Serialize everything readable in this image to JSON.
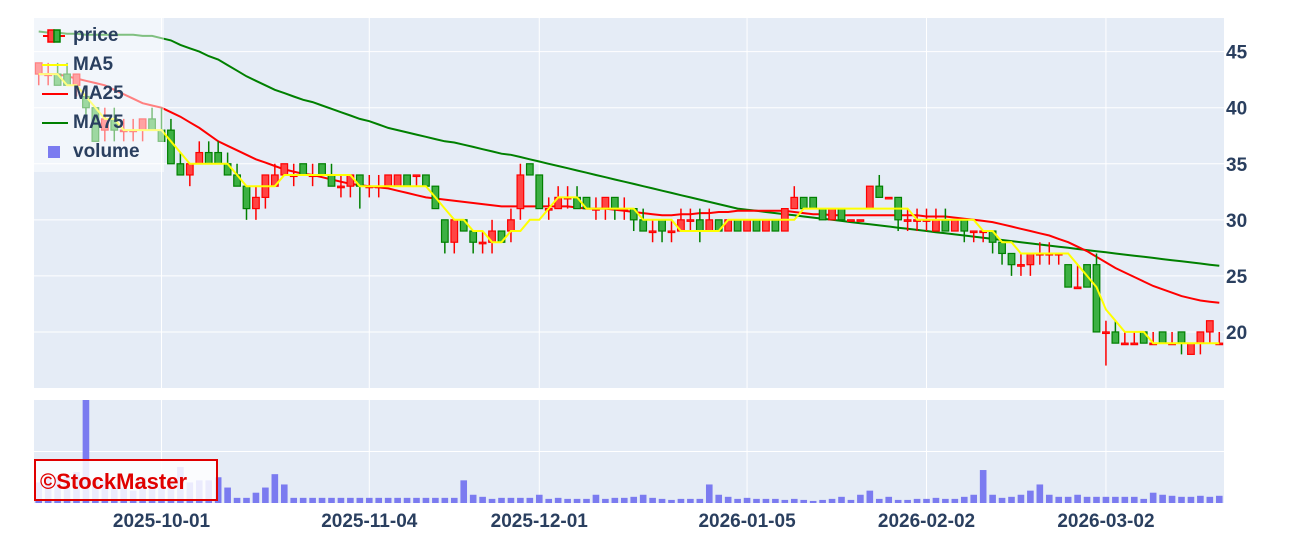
{
  "chart_data": {
    "type": "candlestick",
    "title": "",
    "legend": [
      "price",
      "MA5",
      "MA25",
      "MA75",
      "volume"
    ],
    "legend_position": "top-left",
    "price_axis": {
      "side": "right",
      "range": [
        15,
        48
      ],
      "ticks": [
        20,
        25,
        30,
        35,
        40,
        45
      ]
    },
    "x_tick_labels": [
      "2025-10-01",
      "2025-11-04",
      "2025-12-01",
      "2026-01-05",
      "2026-02-02",
      "2026-03-02"
    ],
    "x_tick_index": [
      13,
      35,
      53,
      75,
      94,
      113
    ],
    "grid": true,
    "colors": {
      "up": "#ff0000",
      "down": "#008000",
      "ma5": "#ffff00",
      "ma25": "#ff0000",
      "ma75": "#008000",
      "volume": "#7b7bf0",
      "plot_bg": "#e5ecf6"
    },
    "candles": [
      [
        43,
        44,
        42,
        44
      ],
      [
        43,
        44,
        42,
        43
      ],
      [
        43,
        44,
        42,
        42
      ],
      [
        43,
        44,
        42,
        42
      ],
      [
        42,
        43,
        41,
        43
      ],
      [
        41,
        42,
        39,
        40
      ],
      [
        40,
        40,
        37,
        37
      ],
      [
        38,
        40,
        37,
        39
      ],
      [
        39,
        40,
        37,
        38
      ],
      [
        38,
        39,
        37,
        38
      ],
      [
        38,
        39,
        37,
        38
      ],
      [
        38,
        39,
        37,
        39
      ],
      [
        39,
        40,
        38,
        38
      ],
      [
        38,
        40,
        37,
        37
      ],
      [
        38,
        39,
        36,
        35
      ],
      [
        35,
        36,
        34,
        34
      ],
      [
        34,
        35,
        33,
        35
      ],
      [
        35,
        37,
        35,
        36
      ],
      [
        36,
        37,
        35,
        35
      ],
      [
        36,
        37,
        35,
        35
      ],
      [
        35,
        36,
        34,
        34
      ],
      [
        34,
        35,
        33,
        33
      ],
      [
        33,
        33,
        30,
        31
      ],
      [
        31,
        33,
        30,
        32
      ],
      [
        32,
        34,
        31,
        34
      ],
      [
        33,
        35,
        33,
        34
      ],
      [
        34,
        35,
        34,
        35
      ],
      [
        34,
        35,
        33,
        34
      ],
      [
        35,
        35,
        34,
        34
      ],
      [
        34,
        35,
        33,
        34
      ],
      [
        35,
        35,
        34,
        34
      ],
      [
        34,
        35,
        33,
        33
      ],
      [
        33,
        34,
        32,
        33
      ],
      [
        33,
        34,
        32,
        34
      ],
      [
        34,
        34,
        31,
        33
      ],
      [
        33,
        34,
        32,
        33
      ],
      [
        33,
        34,
        32,
        33
      ],
      [
        33,
        34,
        33,
        34
      ],
      [
        33,
        34,
        33,
        34
      ],
      [
        34,
        34,
        33,
        33
      ],
      [
        34,
        34,
        33,
        34
      ],
      [
        34,
        34,
        33,
        33
      ],
      [
        33,
        33,
        31,
        31
      ],
      [
        30,
        30,
        27,
        28
      ],
      [
        28,
        30,
        27,
        30
      ],
      [
        30,
        30,
        29,
        29
      ],
      [
        29,
        29,
        27,
        28
      ],
      [
        28,
        29,
        27,
        28
      ],
      [
        28,
        30,
        27,
        29
      ],
      [
        29,
        29,
        28,
        28
      ],
      [
        29,
        31,
        28,
        30
      ],
      [
        31,
        35,
        30,
        34
      ],
      [
        35,
        35,
        34,
        34
      ],
      [
        34,
        34,
        31,
        31
      ],
      [
        31,
        32,
        30,
        31
      ],
      [
        31,
        33,
        31,
        32
      ],
      [
        32,
        33,
        31,
        32
      ],
      [
        32,
        33,
        31,
        31
      ],
      [
        32,
        32,
        31,
        31
      ],
      [
        31,
        32,
        30,
        31
      ],
      [
        31,
        32,
        30,
        32
      ],
      [
        32,
        32,
        30,
        31
      ],
      [
        31,
        32,
        30,
        31
      ],
      [
        31,
        31,
        29,
        30
      ],
      [
        30,
        31,
        29,
        29
      ],
      [
        29,
        30,
        28,
        29
      ],
      [
        30,
        30,
        28,
        29
      ],
      [
        29,
        30,
        28,
        29
      ],
      [
        29,
        31,
        29,
        30
      ],
      [
        30,
        31,
        29,
        30
      ],
      [
        30,
        31,
        28,
        29
      ],
      [
        29,
        31,
        29,
        30
      ],
      [
        30,
        30,
        29,
        29
      ],
      [
        29,
        30,
        29,
        30
      ],
      [
        30,
        30,
        29,
        29
      ],
      [
        29,
        30,
        29,
        30
      ],
      [
        30,
        30,
        29,
        29
      ],
      [
        29,
        30,
        29,
        30
      ],
      [
        30,
        30,
        29,
        29
      ],
      [
        29,
        31,
        29,
        31
      ],
      [
        31,
        33,
        31,
        32
      ],
      [
        32,
        32,
        31,
        31
      ],
      [
        32,
        32,
        31,
        31
      ],
      [
        31,
        31,
        30,
        30
      ],
      [
        30,
        31,
        30,
        31
      ],
      [
        31,
        31,
        30,
        30
      ],
      [
        30,
        30,
        30,
        30
      ],
      [
        30,
        30,
        30,
        30
      ],
      [
        31,
        33,
        31,
        33
      ],
      [
        33,
        34,
        32,
        32
      ],
      [
        32,
        32,
        32,
        32
      ],
      [
        32,
        32,
        29,
        30
      ],
      [
        30,
        31,
        29,
        30
      ],
      [
        30,
        31,
        29,
        30
      ],
      [
        30,
        31,
        29,
        30
      ],
      [
        29,
        31,
        29,
        30
      ],
      [
        30,
        31,
        29,
        29
      ],
      [
        29,
        30,
        29,
        30
      ],
      [
        30,
        30,
        28,
        29
      ],
      [
        29,
        29,
        28,
        29
      ],
      [
        29,
        29,
        28,
        29
      ],
      [
        29,
        29,
        27,
        28
      ],
      [
        28,
        28,
        26,
        27
      ],
      [
        27,
        27,
        25,
        26
      ],
      [
        26,
        27,
        25,
        26
      ],
      [
        26,
        27,
        25,
        27
      ],
      [
        27,
        28,
        26,
        27
      ],
      [
        27,
        28,
        26,
        27
      ],
      [
        27,
        27,
        26,
        27
      ],
      [
        26,
        26,
        24,
        24
      ],
      [
        24,
        26,
        24,
        24
      ],
      [
        26,
        26,
        24,
        24
      ],
      [
        26,
        27,
        23,
        20
      ],
      [
        20,
        21,
        17,
        20
      ],
      [
        20,
        21,
        19,
        19
      ],
      [
        19,
        20,
        19,
        19
      ],
      [
        19,
        20,
        19,
        19
      ],
      [
        20,
        20,
        19,
        19
      ],
      [
        19,
        20,
        19,
        19
      ],
      [
        20,
        20,
        19,
        19
      ],
      [
        19,
        20,
        19,
        19
      ],
      [
        20,
        20,
        18,
        19
      ],
      [
        18,
        19,
        18,
        19
      ],
      [
        19,
        20,
        18,
        20
      ],
      [
        20,
        21,
        19,
        21
      ],
      [
        19,
        20,
        19,
        19
      ]
    ],
    "ma5": [
      43,
      43,
      43,
      42,
      42,
      41,
      40,
      39,
      39,
      38,
      38,
      38,
      38,
      38,
      37,
      36,
      35,
      35,
      35,
      35,
      35,
      34,
      33,
      33,
      33,
      33,
      34,
      34,
      34,
      34,
      34,
      34,
      34,
      34,
      33,
      33,
      33,
      33,
      33,
      33,
      33,
      33,
      32,
      31,
      30,
      30,
      29,
      29,
      28,
      28,
      29,
      29,
      30,
      30,
      31,
      32,
      32,
      32,
      31,
      31,
      31,
      31,
      31,
      31,
      30,
      30,
      30,
      30,
      29,
      29,
      29,
      29,
      29,
      30,
      30,
      30,
      30,
      30,
      30,
      30,
      30,
      31,
      31,
      31,
      31,
      31,
      31,
      31,
      31,
      31,
      31,
      31,
      31,
      30,
      30,
      30,
      30,
      30,
      30,
      30,
      29,
      29,
      28,
      28,
      27,
      27,
      27,
      27,
      27,
      27,
      26,
      25,
      24,
      22,
      21,
      20,
      20,
      20,
      19,
      19,
      19,
      19,
      19,
      19,
      19,
      19
    ],
    "ma25": [
      43,
      43,
      43,
      42.8,
      42.6,
      42.4,
      42.2,
      42,
      41.6,
      41.2,
      40.8,
      40.4,
      40.2,
      40,
      39.6,
      39.2,
      38.7,
      38.2,
      37.6,
      37,
      36.6,
      36.2,
      35.8,
      35.4,
      35.1,
      34.8,
      34.5,
      34.3,
      34.1,
      34,
      33.8,
      33.6,
      33.4,
      33.2,
      33.1,
      33,
      32.9,
      32.8,
      32.6,
      32.4,
      32.2,
      32,
      31.9,
      31.8,
      31.7,
      31.6,
      31.5,
      31.4,
      31.3,
      31.2,
      31.2,
      31.2,
      31.2,
      31.2,
      31.2,
      31.2,
      31.2,
      31.1,
      31,
      31,
      31,
      30.9,
      30.8,
      30.7,
      30.6,
      30.5,
      30.4,
      30.4,
      30.5,
      30.5,
      30.6,
      30.6,
      30.7,
      30.7,
      30.8,
      30.8,
      30.8,
      30.8,
      30.8,
      30.8,
      30.7,
      30.6,
      30.5,
      30.5,
      30.4,
      30.4,
      30.4,
      30.4,
      30.4,
      30.4,
      30.4,
      30.4,
      30.4,
      30.4,
      30.3,
      30.3,
      30.3,
      30.2,
      30.1,
      30,
      29.9,
      29.8,
      29.6,
      29.4,
      29.2,
      29,
      28.8,
      28.6,
      28.3,
      28,
      27.6,
      27.2,
      26.7,
      26.2,
      25.7,
      25.3,
      24.9,
      24.5,
      24.1,
      23.8,
      23.5,
      23.2,
      23,
      22.8,
      22.7,
      22.6
    ],
    "ma75": [
      46.8,
      46.7,
      46.7,
      46.6,
      46.6,
      46.5,
      46.5,
      46.5,
      46.5,
      46.5,
      46.5,
      46.4,
      46.4,
      46.2,
      46,
      45.6,
      45.3,
      45,
      44.6,
      44.3,
      43.8,
      43.3,
      42.8,
      42.4,
      42,
      41.6,
      41.3,
      41,
      40.7,
      40.5,
      40.2,
      39.9,
      39.6,
      39.3,
      39,
      38.8,
      38.5,
      38.2,
      38,
      37.8,
      37.6,
      37.4,
      37.2,
      37,
      36.9,
      36.7,
      36.5,
      36.3,
      36.1,
      35.9,
      35.8,
      35.6,
      35.4,
      35.2,
      35,
      34.8,
      34.6,
      34.4,
      34.2,
      34,
      33.8,
      33.6,
      33.4,
      33.2,
      33,
      32.8,
      32.6,
      32.4,
      32.2,
      32,
      31.8,
      31.6,
      31.4,
      31.2,
      31,
      30.9,
      30.8,
      30.7,
      30.6,
      30.5,
      30.4,
      30.3,
      30.2,
      30.1,
      30,
      29.9,
      29.8,
      29.7,
      29.6,
      29.5,
      29.4,
      29.3,
      29.2,
      29.1,
      29,
      28.9,
      28.8,
      28.7,
      28.6,
      28.5,
      28.4,
      28.3,
      28.2,
      28.1,
      28,
      27.9,
      27.8,
      27.7,
      27.6,
      27.5,
      27.4,
      27.3,
      27.2,
      27.1,
      27,
      26.9,
      26.8,
      26.7,
      26.6,
      26.5,
      26.4,
      26.3,
      26.2,
      26.1,
      26,
      25.9
    ],
    "volume": [
      20,
      25,
      25,
      26,
      30,
      100,
      22,
      22,
      18,
      15,
      12,
      25,
      18,
      15,
      22,
      35,
      20,
      22,
      22,
      25,
      15,
      5,
      5,
      10,
      15,
      28,
      18,
      5,
      5,
      5,
      5,
      5,
      5,
      5,
      5,
      5,
      5,
      5,
      5,
      5,
      5,
      5,
      5,
      5,
      5,
      22,
      8,
      6,
      4,
      5,
      5,
      5,
      5,
      8,
      4,
      5,
      4,
      4,
      4,
      8,
      4,
      5,
      5,
      6,
      8,
      5,
      4,
      3,
      4,
      4,
      4,
      18,
      8,
      6,
      4,
      5,
      4,
      4,
      4,
      3,
      4,
      3,
      2,
      3,
      4,
      6,
      3,
      8,
      12,
      4,
      6,
      3,
      3,
      4,
      4,
      5,
      4,
      4,
      6,
      8,
      32,
      8,
      5,
      6,
      8,
      12,
      18,
      8,
      6,
      6,
      8,
      6,
      6,
      6,
      6,
      6,
      6,
      4,
      10,
      8,
      7,
      6,
      6,
      7,
      6,
      7
    ]
  },
  "watermark": {
    "text": "©StockMaster"
  }
}
